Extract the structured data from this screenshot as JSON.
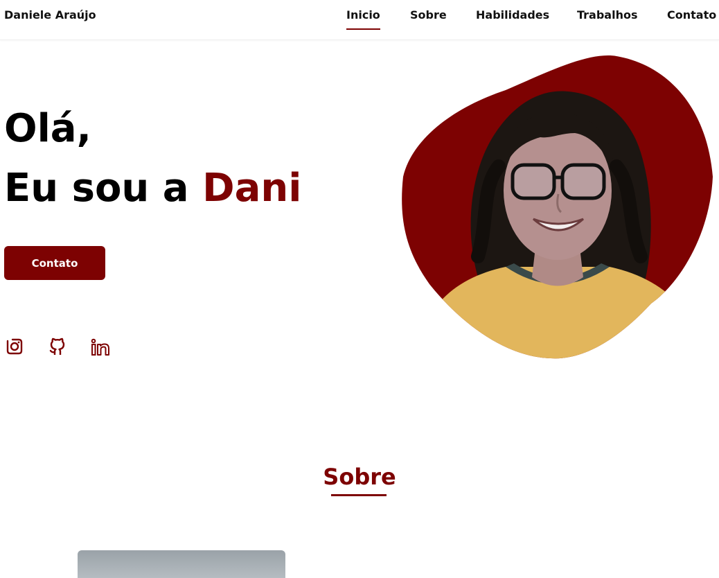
{
  "header": {
    "logo": "Daniele Araújo",
    "nav": [
      {
        "label": "Inicio",
        "active": true
      },
      {
        "label": "Sobre",
        "active": false
      },
      {
        "label": "Habilidades",
        "active": false
      },
      {
        "label": "Trabalhos",
        "active": false
      },
      {
        "label": "Contato",
        "active": false
      }
    ]
  },
  "hero": {
    "line1": "Olá,",
    "line2_prefix": "Eu sou a ",
    "line2_name": "Dani",
    "button": "Contato",
    "social_icons": [
      "instagram-icon",
      "github-icon",
      "linkedin-icon"
    ],
    "photo_icon": "profile-photo"
  },
  "about": {
    "title": "Sobre"
  },
  "colors": {
    "accent": "#7d0202",
    "text": "#111111",
    "background": "#ffffff"
  }
}
